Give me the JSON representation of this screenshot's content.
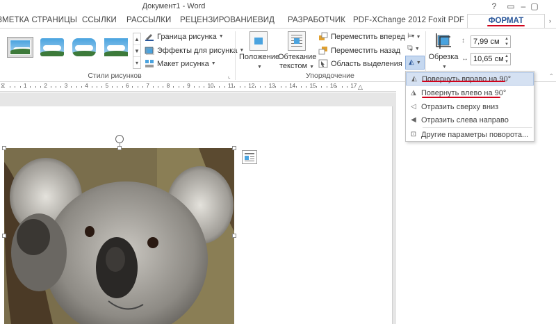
{
  "window": {
    "title": "Документ1 - Word",
    "controls": [
      "?",
      "▭",
      "–",
      "▢"
    ]
  },
  "tabs": [
    {
      "label": "ЗМЕТКА СТРАНИЦЫ"
    },
    {
      "label": "ССЫЛКИ"
    },
    {
      "label": "РАССЫЛКИ"
    },
    {
      "label": "РЕЦЕНЗИРОВАНИЕ"
    },
    {
      "label": "ВИД"
    },
    {
      "label": "РАЗРАБОТЧИК"
    },
    {
      "label": "PDF-XChange 2012"
    },
    {
      "label": "Foxit PDF"
    }
  ],
  "active_tab": {
    "label": "ФОРМАТ"
  },
  "ribbon": {
    "picture_styles": {
      "group_label": "Стили рисунков",
      "commands": [
        {
          "label": "Граница рисунка",
          "icon": "picture-border-icon"
        },
        {
          "label": "Эффекты для рисунка",
          "icon": "picture-effects-icon"
        },
        {
          "label": "Макет рисунка",
          "icon": "picture-layout-icon"
        }
      ]
    },
    "arrange": {
      "group_label": "Упорядочение",
      "position_label": "Положение",
      "wrap_label_1": "Обтекание",
      "wrap_label_2": "текстом",
      "commands": [
        {
          "label": "Переместить вперед",
          "icon": "bring-forward-icon"
        },
        {
          "label": "Переместить назад",
          "icon": "send-backward-icon"
        },
        {
          "label": "Область выделения",
          "icon": "selection-pane-icon"
        }
      ]
    },
    "crop": {
      "label": "Обрезка",
      "height_value": "7,99 см",
      "width_value": "10,65 см"
    }
  },
  "ruler": {
    "numbers": [
      "1",
      "2",
      "3",
      "4",
      "5",
      "6",
      "7",
      "8",
      "9",
      "10",
      "11",
      "12",
      "13",
      "14",
      "15",
      "16",
      "17"
    ]
  },
  "rotate_menu": {
    "items": [
      {
        "label": "Повернуть вправо на 90°",
        "icon": "rotate-right-icon"
      },
      {
        "label": "Повернуть влево на 90°",
        "icon": "rotate-left-icon"
      },
      {
        "label": "Отразить сверху вниз",
        "icon": "flip-vertical-icon"
      },
      {
        "label": "Отразить слева направо",
        "icon": "flip-horizontal-icon"
      },
      {
        "label": "Другие параметры поворота...",
        "icon": "more-rotation-icon"
      }
    ]
  },
  "colors": {
    "accent": "#2b579a",
    "highlight_underline": "#d0021b",
    "menu_hover": "#d5e1f2"
  }
}
